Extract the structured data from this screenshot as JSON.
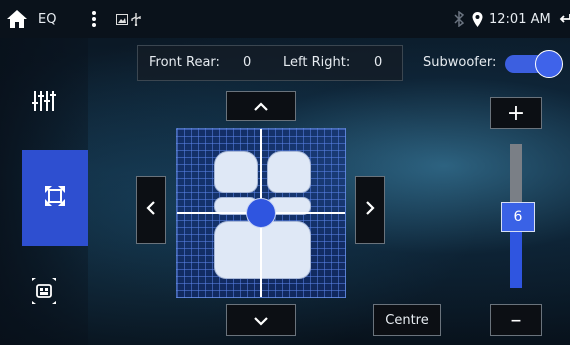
{
  "status_bar": {
    "app_title": "EQ",
    "time": "12:01 AM"
  },
  "sidebar": {
    "items": [
      {
        "name": "equalizer",
        "icon": "sliders-icon",
        "active": false
      },
      {
        "name": "balance-fader",
        "icon": "expand-corners-icon",
        "active": true
      },
      {
        "name": "sound-field",
        "icon": "seat-speakers-icon",
        "active": false
      }
    ]
  },
  "readout": {
    "front_rear_label": "Front Rear:",
    "front_rear_value": "0",
    "left_right_label": "Left Right:",
    "left_right_value": "0"
  },
  "subwoofer": {
    "label": "Subwoofer:",
    "enabled": true
  },
  "balance": {
    "centre_label": "Centre",
    "up_icon": "chevron-up-icon",
    "down_icon": "chevron-down-icon",
    "left_icon": "chevron-left-icon",
    "right_icon": "chevron-right-icon"
  },
  "subwoofer_level": {
    "value": "6",
    "plus_label": "+",
    "minus_label": "–",
    "fill_fraction": 0.5
  },
  "colors": {
    "accent": "#2e4fd0",
    "knob": "#2f55e0"
  }
}
